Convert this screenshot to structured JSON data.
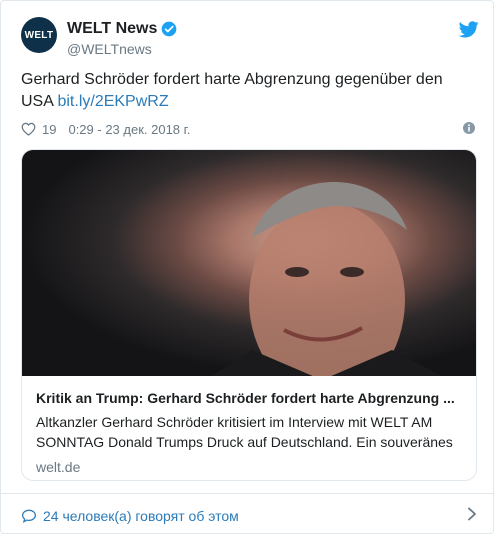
{
  "account": {
    "avatar_text": "WELT",
    "display_name": "WELT News",
    "handle": "@WELTnews",
    "verified": true
  },
  "tweet": {
    "text": "Gerhard Schröder fordert harte Abgrenzung gegenüber den USA",
    "link": "bit.ly/2EKPwRZ"
  },
  "meta": {
    "likes": "19",
    "timestamp": "0:29 - 23 дек. 2018 г."
  },
  "card": {
    "title": "Kritik an Trump: Gerhard Schröder fordert harte Abgrenzung ...",
    "description": "Altkanzler Gerhard Schröder kritisiert im Interview mit WELT AM SONNTAG Donald Trumps Druck auf Deutschland. Ein souveränes",
    "domain": "welt.de"
  },
  "footer": {
    "conversation": "24 человек(а) говорят об этом"
  },
  "colors": {
    "link": "#2b7bb9",
    "muted": "#697882",
    "twitter_blue": "#1da1f2",
    "avatar_bg": "#0f3049"
  },
  "icons": [
    "verified-icon",
    "twitter-bird-icon",
    "heart-icon",
    "info-icon",
    "speech-bubble-icon",
    "chevron-right-icon"
  ]
}
